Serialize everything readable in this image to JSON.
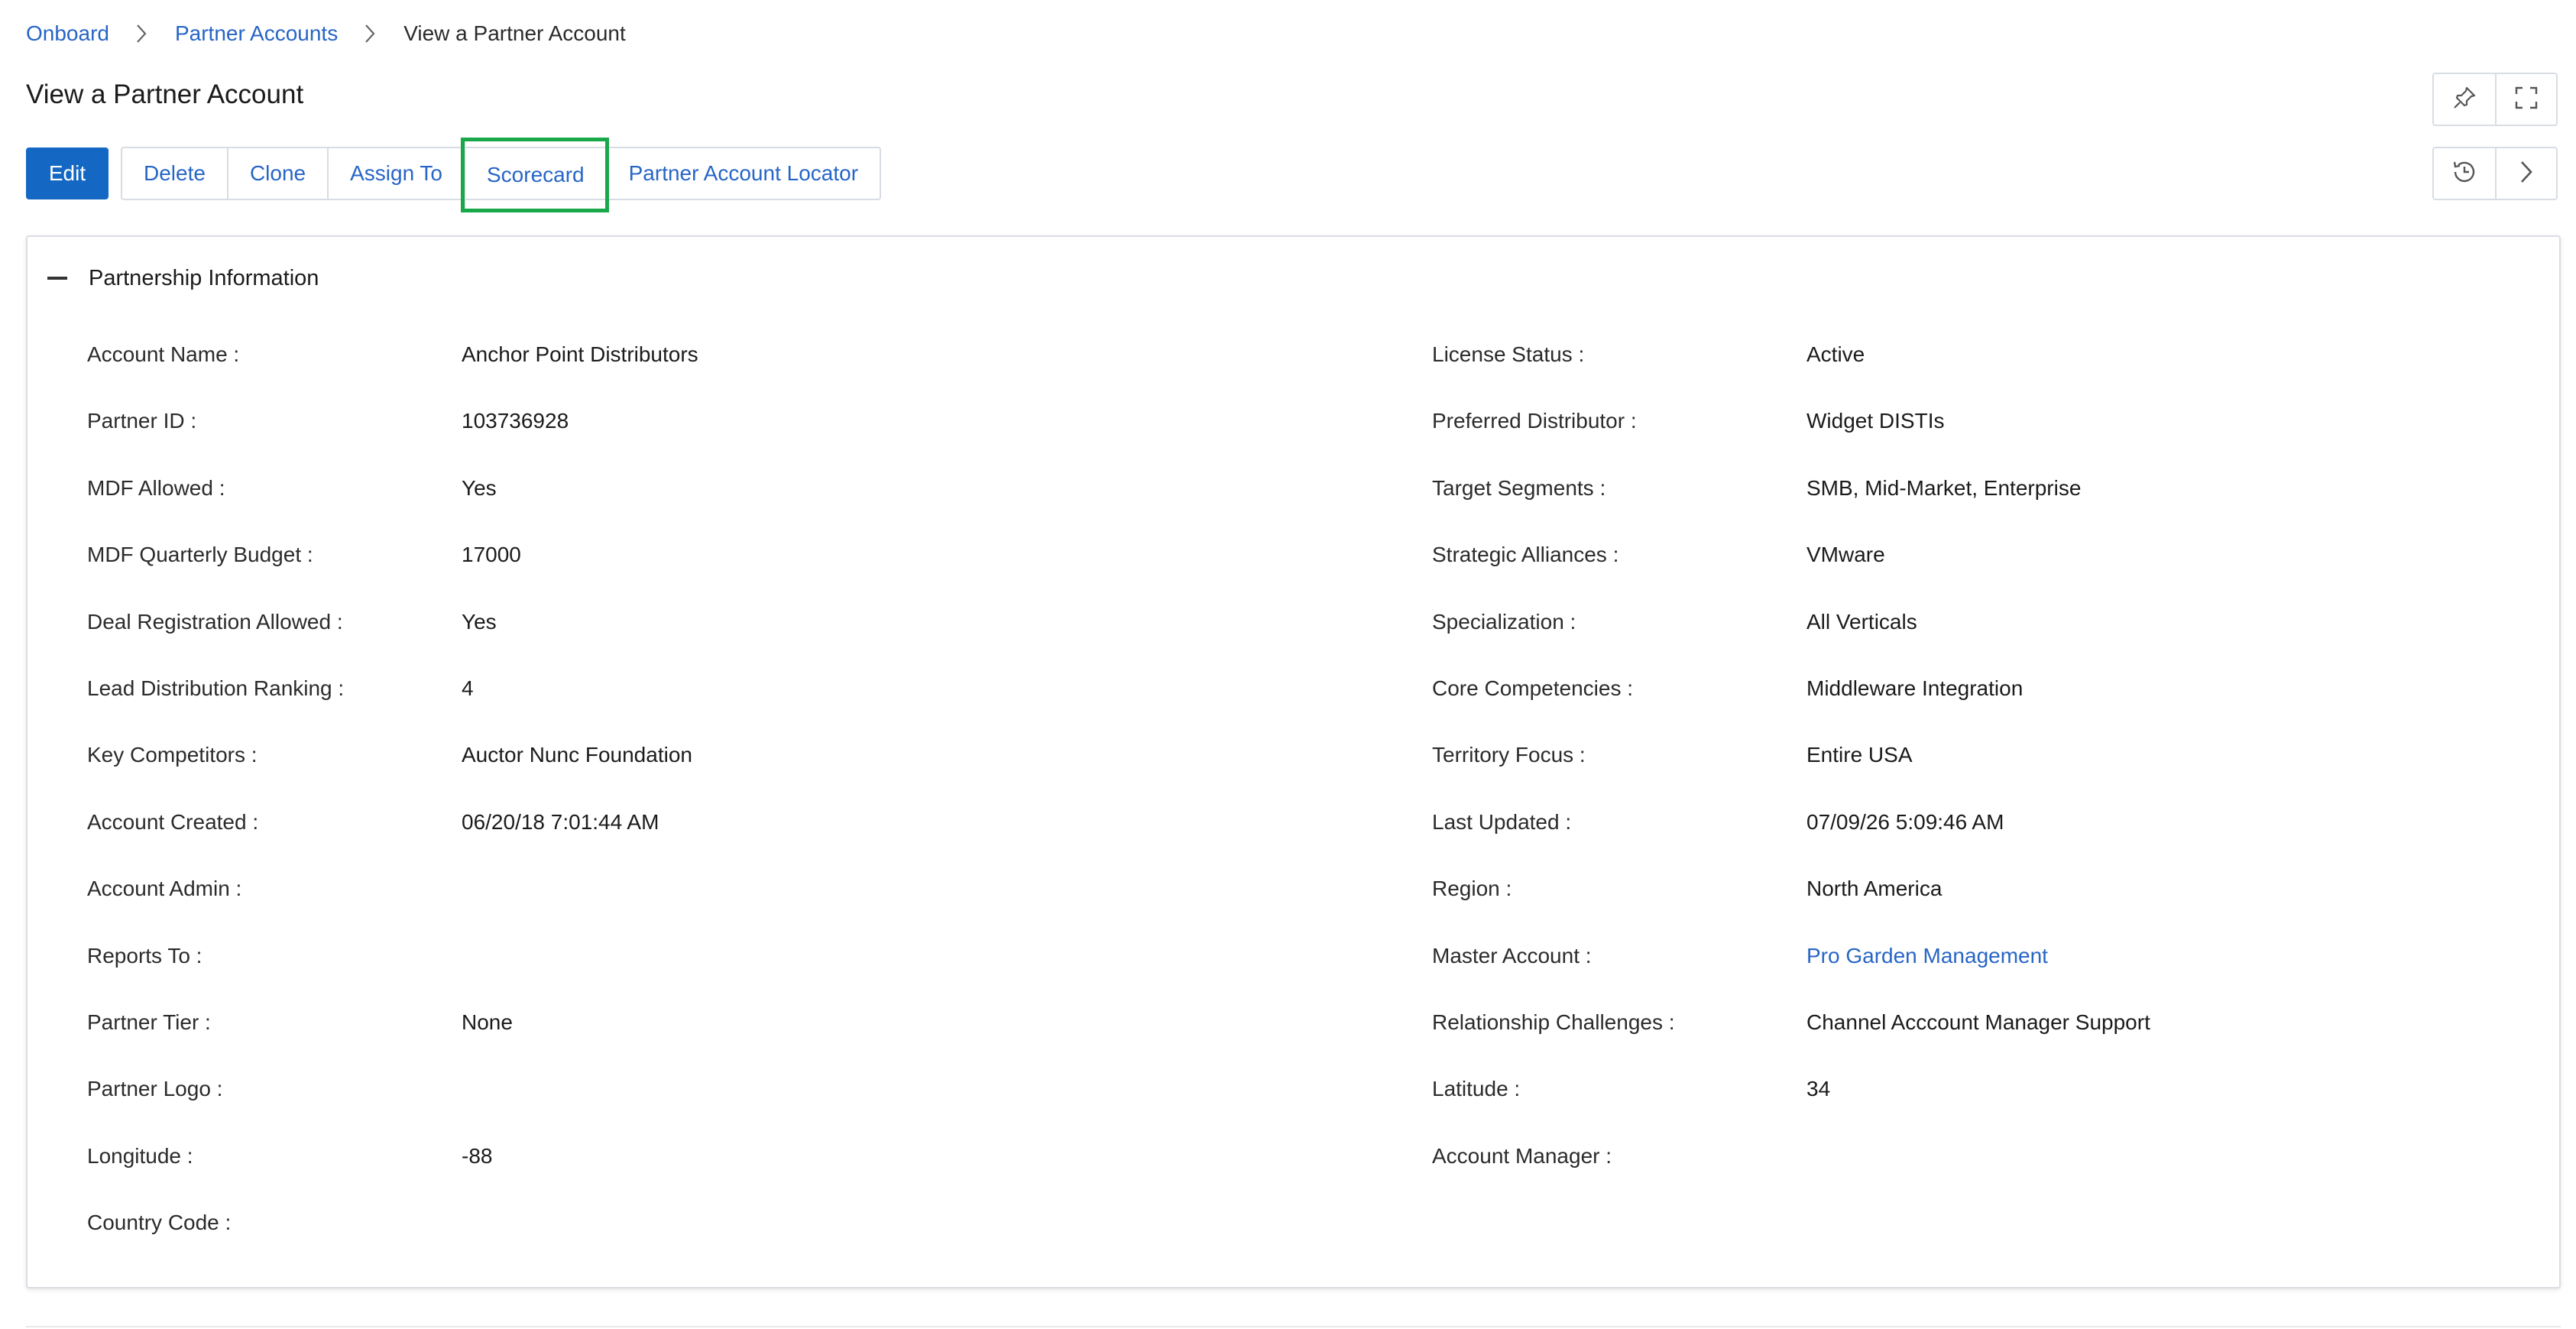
{
  "breadcrumb": {
    "items": [
      "Onboard",
      "Partner Accounts",
      "View a Partner Account"
    ]
  },
  "page_title": "View a Partner Account",
  "toolbar": {
    "edit_label": "Edit",
    "delete_label": "Delete",
    "clone_label": "Clone",
    "assign_to_label": "Assign To",
    "scorecard_label": "Scorecard",
    "locator_label": "Partner Account Locator"
  },
  "icons": {
    "pin": "pin-icon",
    "expand": "expand-icon",
    "history": "history-icon",
    "next": "chevron-right-icon"
  },
  "colors": {
    "primary": "#1468c4",
    "link": "#2765c6",
    "highlight": "#18a84a"
  },
  "section": {
    "title": "Partnership Information",
    "left": [
      {
        "label": "Account Name :",
        "value": "Anchor Point Distributors"
      },
      {
        "label": "Partner ID :",
        "value": "103736928"
      },
      {
        "label": "MDF Allowed :",
        "value": "Yes"
      },
      {
        "label": "MDF Quarterly Budget :",
        "value": "17000"
      },
      {
        "label": "Deal Registration Allowed :",
        "value": "Yes"
      },
      {
        "label": "Lead Distribution Ranking :",
        "value": "4"
      },
      {
        "label": "Key Competitors :",
        "value": "Auctor Nunc Foundation"
      },
      {
        "label": "Account Created :",
        "value": "06/20/18 7:01:44 AM"
      },
      {
        "label": "Account Admin :",
        "value": ""
      },
      {
        "label": "Reports To :",
        "value": ""
      },
      {
        "label": "Partner Tier :",
        "value": "None"
      },
      {
        "label": "Partner Logo :",
        "value": ""
      },
      {
        "label": "Longitude :",
        "value": "-88"
      },
      {
        "label": "Country Code :",
        "value": ""
      }
    ],
    "right": [
      {
        "label": "License Status :",
        "value": "Active"
      },
      {
        "label": "Preferred Distributor :",
        "value": "Widget DISTIs"
      },
      {
        "label": "Target Segments :",
        "value": "SMB, Mid-Market, Enterprise"
      },
      {
        "label": "Strategic Alliances :",
        "value": "VMware"
      },
      {
        "label": "Specialization :",
        "value": "All Verticals"
      },
      {
        "label": "Core Competencies :",
        "value": "Middleware Integration"
      },
      {
        "label": "Territory Focus :",
        "value": "Entire USA"
      },
      {
        "label": "Last Updated :",
        "value": "07/09/26 5:09:46 AM"
      },
      {
        "label": "Region :",
        "value": "North America"
      },
      {
        "label": "Master Account :",
        "value": "Pro Garden Management"
      },
      {
        "label": "Relationship Challenges :",
        "value": "Channel Acccount Manager Support"
      },
      {
        "label": "Latitude :",
        "value": "34"
      },
      {
        "label": "Account Manager :",
        "value": ""
      }
    ]
  }
}
